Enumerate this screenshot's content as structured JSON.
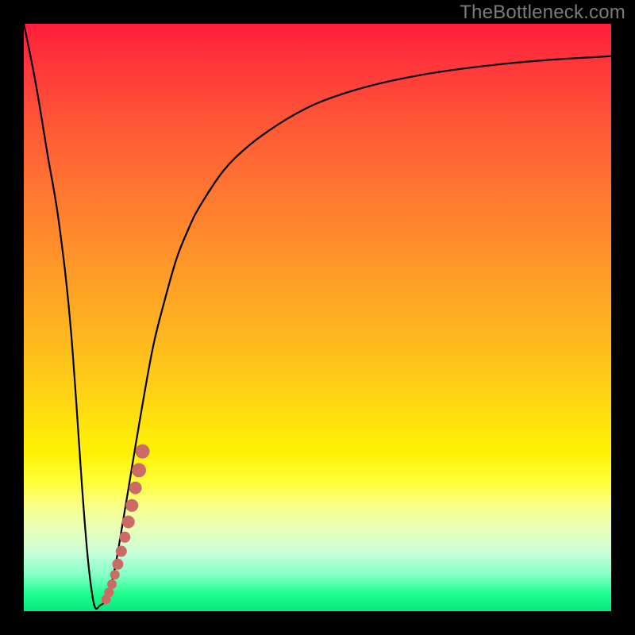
{
  "watermark": "TheBottleneck.com",
  "colors": {
    "curve": "#000000",
    "markers": "#cc6b66",
    "frame": "#000000"
  },
  "chart_data": {
    "type": "line",
    "title": "",
    "xlabel": "",
    "ylabel": "",
    "xlim": [
      0,
      100
    ],
    "ylim": [
      0,
      100
    ],
    "series": [
      {
        "name": "bottleneck-curve",
        "x": [
          0,
          2,
          4,
          6,
          8,
          10,
          11,
          12,
          13,
          14,
          15,
          16,
          18,
          20,
          22,
          24,
          26,
          28,
          30,
          34,
          38,
          42,
          46,
          50,
          55,
          60,
          65,
          70,
          75,
          80,
          85,
          90,
          95,
          100
        ],
        "y": [
          100,
          90,
          78,
          66,
          48,
          20,
          8,
          1,
          1,
          2,
          5,
          10,
          22,
          34,
          45,
          53,
          60,
          65,
          69,
          75,
          79,
          82,
          84.5,
          86.5,
          88.3,
          89.7,
          90.8,
          91.7,
          92.4,
          93.0,
          93.5,
          93.9,
          94.2,
          94.5
        ]
      }
    ],
    "markers": {
      "name": "highlight-segment",
      "points": [
        {
          "x": 14.0,
          "y": 2.0,
          "r": 6
        },
        {
          "x": 14.5,
          "y": 3.2,
          "r": 6
        },
        {
          "x": 15.0,
          "y": 4.6,
          "r": 6
        },
        {
          "x": 15.5,
          "y": 6.2,
          "r": 6
        },
        {
          "x": 16.0,
          "y": 8.0,
          "r": 7
        },
        {
          "x": 16.6,
          "y": 10.2,
          "r": 7
        },
        {
          "x": 17.2,
          "y": 12.6,
          "r": 7
        },
        {
          "x": 17.8,
          "y": 15.2,
          "r": 8
        },
        {
          "x": 18.4,
          "y": 18.0,
          "r": 8
        },
        {
          "x": 19.0,
          "y": 21.0,
          "r": 8
        },
        {
          "x": 19.6,
          "y": 24.0,
          "r": 9
        },
        {
          "x": 20.2,
          "y": 27.2,
          "r": 9
        }
      ]
    }
  }
}
